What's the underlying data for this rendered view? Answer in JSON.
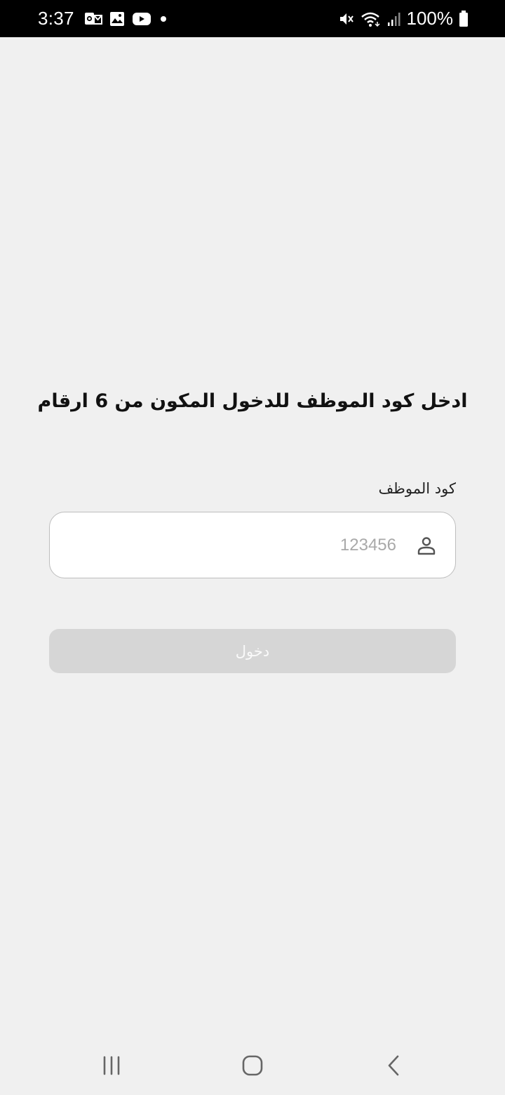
{
  "status_bar": {
    "time": "3:37",
    "battery": "100%",
    "left_icons": [
      "outlook-icon",
      "gallery-icon",
      "youtube-icon",
      "dot-icon"
    ],
    "right_icons": [
      "mute-icon",
      "wifi-icon",
      "signal-icon",
      "battery-icon"
    ]
  },
  "login": {
    "heading": "ادخل كود الموظف للدخول المكون من 6 ارقام",
    "field_label": "كود الموظف",
    "field_placeholder": "123456",
    "field_value": "",
    "button_label": "دخول"
  },
  "colors": {
    "background": "#f0f0f0",
    "button_disabled": "#d6d6d6",
    "status_bar": "#000000"
  },
  "nav": {
    "buttons": [
      "recents-icon",
      "home-icon",
      "back-icon"
    ]
  }
}
